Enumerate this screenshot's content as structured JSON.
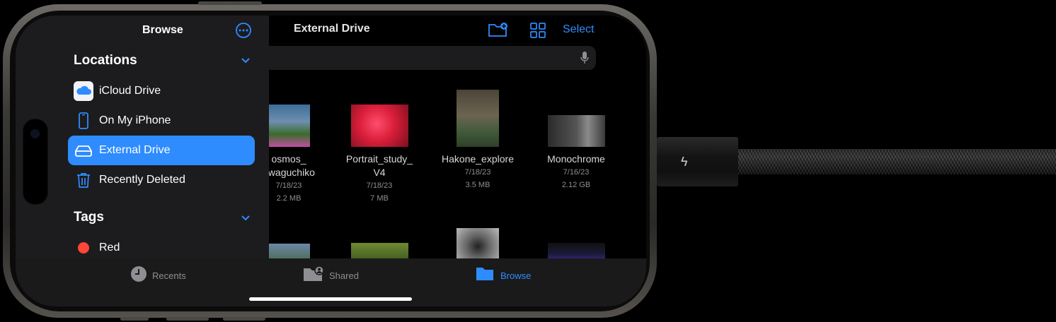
{
  "main": {
    "title": "External Drive",
    "select_label": "Select",
    "toolbar_icons": [
      "new-folder-icon",
      "grid-view-icon"
    ],
    "search_icon": "microphone-icon",
    "files": [
      {
        "name_line1": "osmos_",
        "name_line2": "awaguchiko",
        "date": "7/18/23",
        "size": "2.2 MB"
      },
      {
        "name_line1": "Portrait_study_",
        "name_line2": "V4",
        "date": "7/18/23",
        "size": "7 MB"
      },
      {
        "name_line1": "Hakone_explore",
        "name_line2": "",
        "date": "7/18/23",
        "size": "3.5 MB"
      },
      {
        "name_line1": "Monochrome",
        "name_line2": "",
        "date": "7/16/23",
        "size": "2.12 GB"
      }
    ]
  },
  "sidebar": {
    "title": "Browse",
    "more_icon": "ellipsis-circle-icon",
    "locations_header": "Locations",
    "tags_header": "Tags",
    "locations": [
      {
        "label": "iCloud Drive",
        "icon": "icloud-icon"
      },
      {
        "label": "On My iPhone",
        "icon": "iphone-icon"
      },
      {
        "label": "External Drive",
        "icon": "external-drive-icon",
        "selected": true
      },
      {
        "label": "Recently Deleted",
        "icon": "trash-icon"
      }
    ],
    "tags": [
      {
        "label": "Red",
        "color": "#ff453a"
      }
    ]
  },
  "tabbar": {
    "tabs": [
      {
        "label": "Recents",
        "icon": "clock-icon"
      },
      {
        "label": "Shared",
        "icon": "shared-folder-icon"
      },
      {
        "label": "Browse",
        "icon": "folder-icon",
        "active": true
      }
    ]
  },
  "colors": {
    "accent": "#2f8cff",
    "sidebar_bg": "#1c1c1e",
    "tab_inactive": "#8e8e93"
  }
}
